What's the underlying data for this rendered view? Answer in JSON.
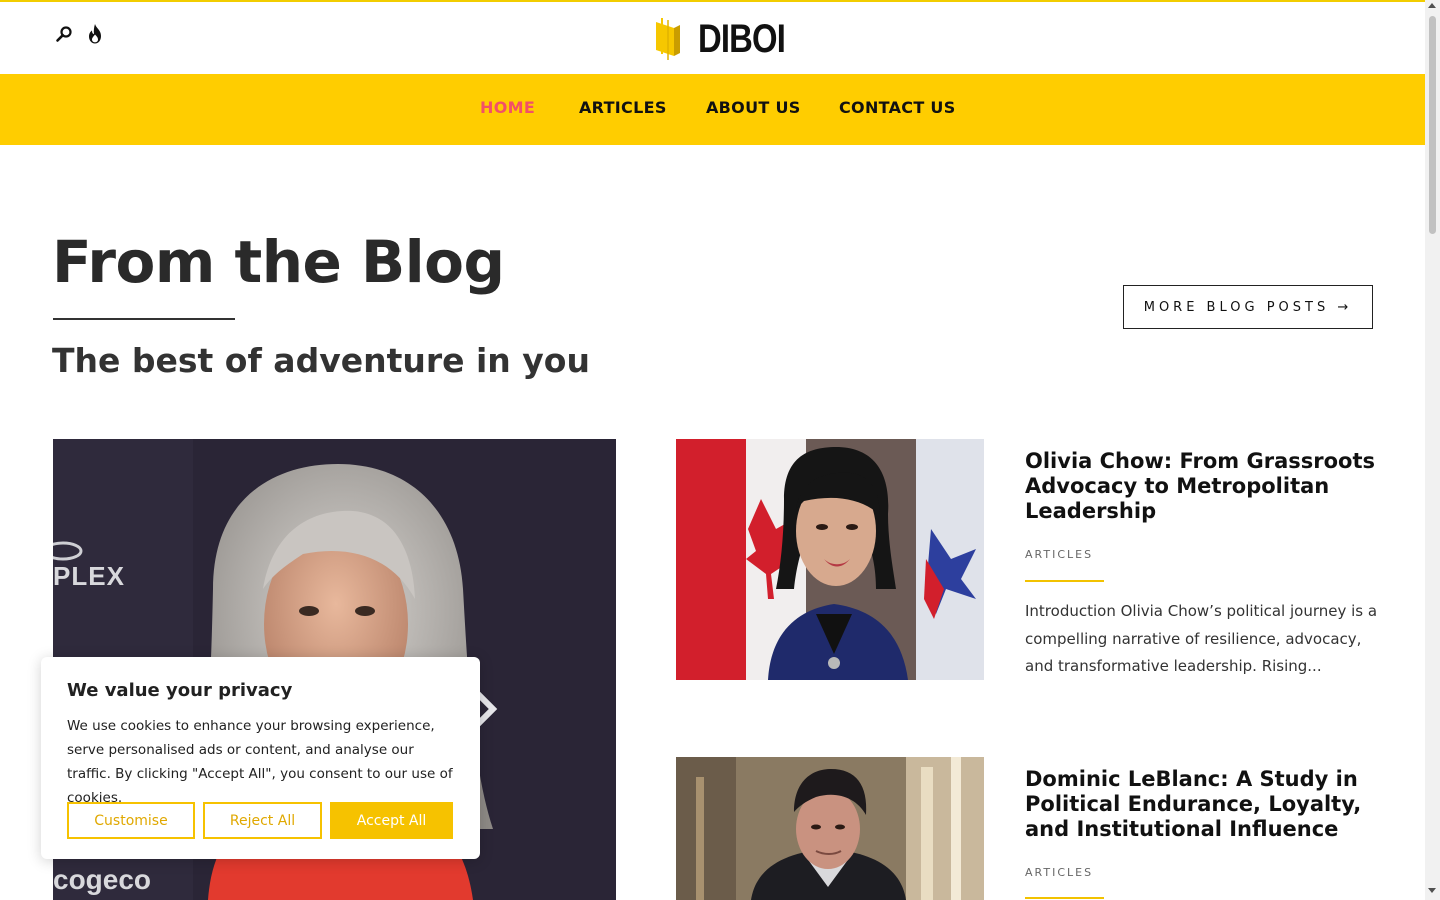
{
  "header": {
    "logo_text": "DIBOI",
    "search_icon": "search-icon",
    "fire_icon": "fire-icon"
  },
  "nav": {
    "items": [
      {
        "label": "HOME",
        "active": true
      },
      {
        "label": "ARTICLES",
        "active": false
      },
      {
        "label": "ABOUT US",
        "active": false
      },
      {
        "label": "CONTACT US",
        "active": false
      }
    ]
  },
  "blog": {
    "title": "From the Blog",
    "subtitle": "The best of adventure in you",
    "more_button": "MORE BLOG POSTS →"
  },
  "posts": [
    {
      "title": "Olivia Chow: From Grassroots Advocacy to Metropolitan Leadership",
      "category": "ARTICLES",
      "excerpt": "Introduction Olivia Chow’s political journey is a compelling narrative of resilience, advocacy, and transformative leadership. Rising..."
    },
    {
      "title": "Dominic LeBlanc: A Study in Political Endurance, Loyalty, and Institutional Influence",
      "category": "ARTICLES"
    }
  ],
  "cookie": {
    "title": "We value your privacy",
    "text": "We use cookies to enhance your browsing experience, serve personalised ads or content, and analyse our traffic. By clicking \"Accept All\", you consent to our use of cookies.",
    "customise": "Customise",
    "reject": "Reject All",
    "accept": "Accept All"
  },
  "colors": {
    "accent": "#ffcd00",
    "nav_active": "#f25068",
    "cookie_accent": "#f6c200"
  }
}
